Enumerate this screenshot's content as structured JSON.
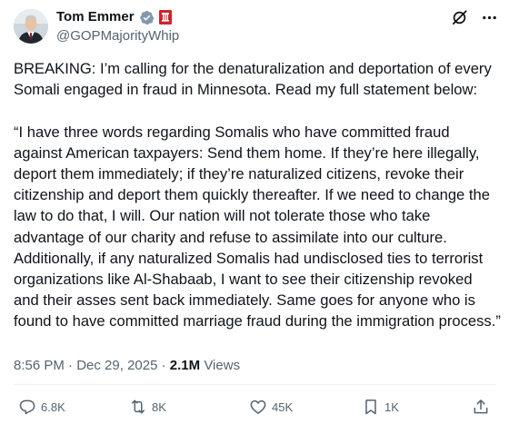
{
  "author": {
    "name": "Tom Emmer",
    "handle": "@GOPMajorityWhip"
  },
  "tweet": {
    "text": "BREAKING: I’m calling for the denaturalization and deportation of every Somali engaged in fraud in Minnesota. Read my full statement below:\n\n“I have three words regarding Somalis who have committed fraud against American taxpayers: Send them home. If they’re here illegally, deport them immediately; if they’re naturalized citizens, revoke their citizenship and deport them quickly thereafter. If we need to change the law to do that, I will. Our nation will not tolerate those who take advantage of our charity and refuse to assimilate into our culture. Additionally, if any naturalized Somalis had undisclosed ties to terrorist organizations like Al-Shabaab, I want to see their citizenship revoked and their asses sent back immediately. Same goes for anyone who is found to have committed marriage fraud during the immigration process.”"
  },
  "meta": {
    "time": "8:56 PM",
    "separator": "·",
    "date": "Dec 29, 2025",
    "views_count": "2.1M",
    "views_label": "Views"
  },
  "actions": {
    "replies": "6.8K",
    "reposts": "8K",
    "likes": "45K",
    "bookmarks": "1K"
  },
  "icons": {
    "badge": "gray-verified-badge-icon",
    "flag": "congress-flag-icon",
    "grok": "grok-icon",
    "more": "more-icon"
  },
  "colors": {
    "text": "#0f1419",
    "secondary": "#536471",
    "badge": "#829aab",
    "flag": "#d0232a",
    "divider": "#eff3f4"
  }
}
